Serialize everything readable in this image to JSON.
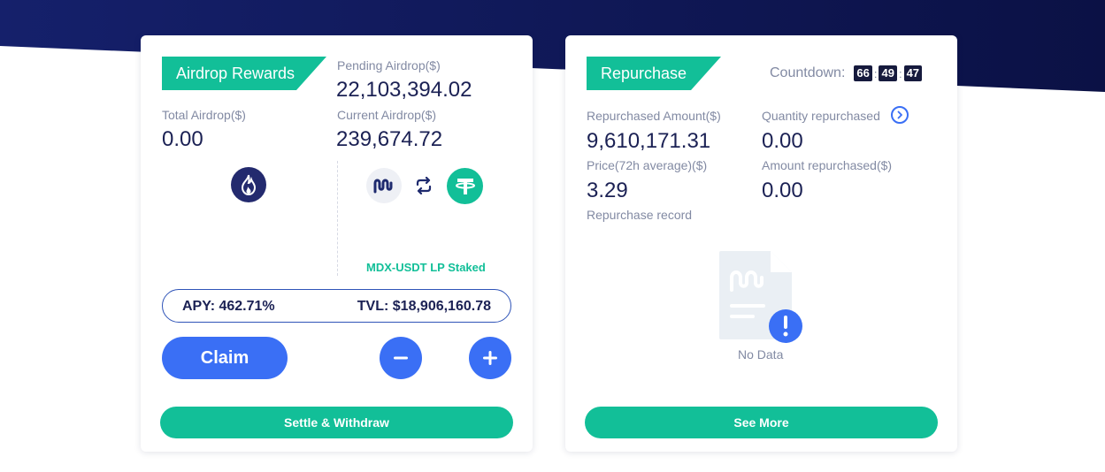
{
  "airdrop": {
    "tag": "Airdrop Rewards",
    "pending_label": "Pending Airdrop($)",
    "pending_value": "22,103,394.02",
    "total_label": "Total Airdrop($)",
    "total_value": "0.00",
    "current_label": "Current Airdrop($)",
    "current_value": "239,674.72",
    "lp_label": "MDX-USDT LP Staked",
    "apy": "APY: 462.71%",
    "tvl": "TVL: $18,906,160.78",
    "claim_label": "Claim",
    "settle_label": "Settle & Withdraw",
    "icons": [
      "ht-token-icon",
      "mdx-token-icon",
      "swap-icon",
      "usdt-token-icon",
      "minus-icon",
      "plus-icon"
    ]
  },
  "repurchase": {
    "tag": "Repurchase",
    "countdown_label": "Countdown:",
    "countdown_h": "66",
    "countdown_m": "49",
    "countdown_s": "47",
    "amount_label": "Repurchased Amount($)",
    "amount_value": "9,610,171.31",
    "quantity_label": "Quantity repurchased",
    "quantity_value": "0.00",
    "price_label": "Price(72h average)($)",
    "price_value": "3.29",
    "amount_rep_label": "Amount repurchased($)",
    "amount_rep_value": "0.00",
    "record_label": "Repurchase record",
    "no_data": "No Data",
    "see_more_label": "See More"
  },
  "colors": {
    "accent_green": "#12bf98",
    "accent_blue": "#3a6ff5",
    "navy": "#0f1650",
    "text_dark": "#1b2154",
    "text_muted": "#828aa3"
  }
}
